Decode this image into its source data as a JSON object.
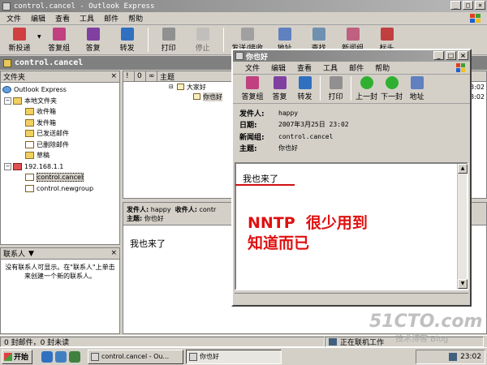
{
  "main_window": {
    "title": "control.cancel - Outlook Express",
    "menu": [
      "文件",
      "编辑",
      "查看",
      "工具",
      "邮件",
      "帮助"
    ],
    "toolbar": [
      {
        "label": "新投递",
        "icon": "new-post-icon",
        "dropdown": true
      },
      {
        "label": "答复组",
        "icon": "reply-group-icon"
      },
      {
        "label": "答复",
        "icon": "reply-icon"
      },
      {
        "label": "转发",
        "icon": "forward-icon"
      },
      {
        "label": "打印",
        "icon": "print-icon"
      },
      {
        "label": "停止",
        "icon": "stop-icon"
      },
      {
        "label": "发送/接收",
        "icon": "send-receive-icon",
        "dropdown": true
      },
      {
        "label": "地址",
        "icon": "addresses-icon"
      },
      {
        "label": "查找",
        "icon": "find-icon",
        "dropdown": true
      },
      {
        "label": "新闻组",
        "icon": "newsgroups-icon"
      },
      {
        "label": "标头",
        "icon": "headers-icon"
      }
    ],
    "address_bar": "control.cancel",
    "folders": {
      "header": "文件夹",
      "items": [
        {
          "label": "Outlook Express",
          "level": 0
        },
        {
          "label": "本地文件夹",
          "level": 1
        },
        {
          "label": "收件箱",
          "level": 2
        },
        {
          "label": "发件箱",
          "level": 2
        },
        {
          "label": "已发送邮件",
          "level": 2
        },
        {
          "label": "已删除邮件",
          "level": 2
        },
        {
          "label": "草稿",
          "level": 2
        },
        {
          "label": "192.168.1.1",
          "level": 1
        },
        {
          "label": "control.cancel",
          "level": 2
        },
        {
          "label": "control.newgroup",
          "level": 2
        }
      ]
    },
    "contacts": {
      "header": "联系人",
      "empty_text": "没有联系人可显示。在\"联系人\"上单击来创建一个新的联系人。"
    },
    "message_list": {
      "columns": [
        "!",
        "0",
        "∞",
        "主题"
      ],
      "rows": [
        {
          "subject": "大家好",
          "date": "23:02"
        },
        {
          "subject": "你也好",
          "date": "23:02"
        }
      ]
    },
    "preview": {
      "from_label": "发件人:",
      "from": "happy",
      "to_label": "收件人:",
      "to": "contr",
      "subject_label": "主题:",
      "subject": "你也好",
      "body": "我也来了"
    },
    "status": {
      "counts": "0 封邮件，0 封未读",
      "online": "正在联机工作"
    }
  },
  "message_window": {
    "title": "你也好",
    "menu": [
      "文件",
      "编辑",
      "查看",
      "工具",
      "邮件",
      "帮助"
    ],
    "toolbar": [
      {
        "label": "答复组",
        "icon": "reply-group-icon"
      },
      {
        "label": "答复",
        "icon": "reply-icon"
      },
      {
        "label": "转发",
        "icon": "forward-icon"
      },
      {
        "label": "打印",
        "icon": "print-icon"
      },
      {
        "label": "上一封",
        "icon": "previous-icon"
      },
      {
        "label": "下一封",
        "icon": "next-icon"
      },
      {
        "label": "地址",
        "icon": "addresses-icon"
      }
    ],
    "headers": {
      "from_label": "发件人:",
      "from": "happy",
      "date_label": "日期:",
      "date": "2007年3月25日 23:02",
      "newsgroup_label": "新闻组:",
      "newsgroup": "control.cancel",
      "subject_label": "主题:",
      "subject": "你也好"
    },
    "body": "我也来了"
  },
  "annotation": {
    "line1": "NNTP  很少用到",
    "line2": "知道而已",
    "color": "#e01010"
  },
  "watermark": {
    "main": "51CTO.com",
    "sub": "技术博客  Blog"
  },
  "taskbar": {
    "start": "开始",
    "tasks": [
      {
        "label": "control.cancel - Ou...",
        "active": false
      },
      {
        "label": "你也好",
        "active": true
      }
    ],
    "clock": "23:02"
  }
}
